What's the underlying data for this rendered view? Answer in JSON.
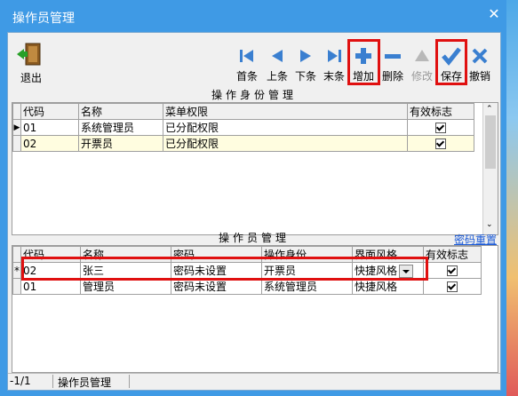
{
  "window": {
    "title": "操作员管理",
    "close_glyph": "✕"
  },
  "toolbar": {
    "exit_label": "退出",
    "buttons": [
      {
        "label": "首条",
        "icon": "first-record-icon"
      },
      {
        "label": "上条",
        "icon": "previous-record-icon"
      },
      {
        "label": "下条",
        "icon": "next-record-icon"
      },
      {
        "label": "末条",
        "icon": "last-record-icon"
      },
      {
        "label": "增加",
        "icon": "add-icon"
      },
      {
        "label": "删除",
        "icon": "delete-icon"
      },
      {
        "label": "修改",
        "icon": "edit-icon",
        "disabled": true
      },
      {
        "label": "保存",
        "icon": "save-icon"
      },
      {
        "label": "撤销",
        "icon": "undo-icon"
      }
    ]
  },
  "role_section": {
    "caption": "操作身份管理",
    "columns": [
      "代码",
      "名称",
      "菜单权限",
      "有效标志"
    ],
    "rows": [
      {
        "code": "01",
        "name": "系统管理员",
        "menu": "已分配权限",
        "valid": true
      },
      {
        "code": "02",
        "name": "开票员",
        "menu": "已分配权限",
        "valid": true
      }
    ]
  },
  "operator_section": {
    "caption": "操作员管理",
    "reset_link": "密码重置",
    "columns": [
      "代码",
      "名称",
      "密码",
      "操作身份",
      "界面风格",
      "有效标志"
    ],
    "rows": [
      {
        "marker": "*",
        "code": "02",
        "name": "张三",
        "password": "密码未设置",
        "role": "开票员",
        "style": "快捷风格",
        "valid": true
      },
      {
        "marker": "",
        "code": "01",
        "name": "管理员",
        "password": "密码未设置",
        "role": "系统管理员",
        "style": "快捷风格",
        "valid": true
      }
    ]
  },
  "status_bar": {
    "position": "-1/1",
    "module": "操作员管理"
  },
  "colors": {
    "titlebar": "#3f9ae5",
    "highlight": "#e01010",
    "link": "#1a5ad8",
    "selected_row": "#fffde0"
  }
}
